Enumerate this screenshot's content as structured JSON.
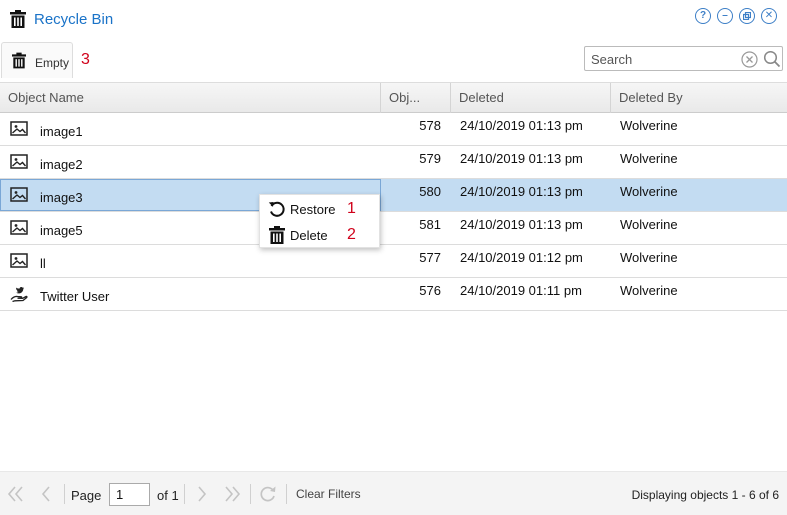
{
  "window": {
    "title": "Recycle Bin",
    "controls": [
      "help-icon",
      "minimize-icon",
      "restore-icon",
      "close-icon"
    ]
  },
  "toolbar": {
    "empty_label": "Empty",
    "empty_annotation": "3",
    "search_placeholder": "Search"
  },
  "grid": {
    "columns": [
      "Object Name",
      "Obj...",
      "Deleted",
      "Deleted By"
    ],
    "rows": [
      {
        "icon": "image-icon",
        "name": "image1",
        "id": "578",
        "deleted": "24/10/2019 01:13 pm",
        "by": "Wolverine"
      },
      {
        "icon": "image-icon",
        "name": "image2",
        "id": "579",
        "deleted": "24/10/2019 01:13 pm",
        "by": "Wolverine"
      },
      {
        "icon": "image-icon",
        "name": "image3",
        "id": "580",
        "deleted": "24/10/2019 01:13 pm",
        "by": "Wolverine"
      },
      {
        "icon": "image-icon",
        "name": "image5",
        "id": "581",
        "deleted": "24/10/2019 01:13 pm",
        "by": "Wolverine"
      },
      {
        "icon": "image-icon",
        "name": "ll",
        "id": "577",
        "deleted": "24/10/2019 01:12 pm",
        "by": "Wolverine"
      },
      {
        "icon": "twitter-user-icon",
        "name": "Twitter User",
        "id": "576",
        "deleted": "24/10/2019 01:11 pm",
        "by": "Wolverine"
      }
    ]
  },
  "context_menu": {
    "items": [
      {
        "icon": "restore-icon",
        "label": "Restore",
        "annotation": "1"
      },
      {
        "icon": "trash-icon",
        "label": "Delete",
        "annotation": "2"
      }
    ]
  },
  "pager": {
    "page_label": "Page",
    "page_value": "1",
    "of_label": "of 1",
    "clear_filters": "Clear Filters",
    "display_info": "Displaying objects 1 - 6 of 6"
  },
  "colors": {
    "accent": "#1a73c8",
    "selected_row": "#c3dcf2",
    "annotation": "#d0021b"
  }
}
